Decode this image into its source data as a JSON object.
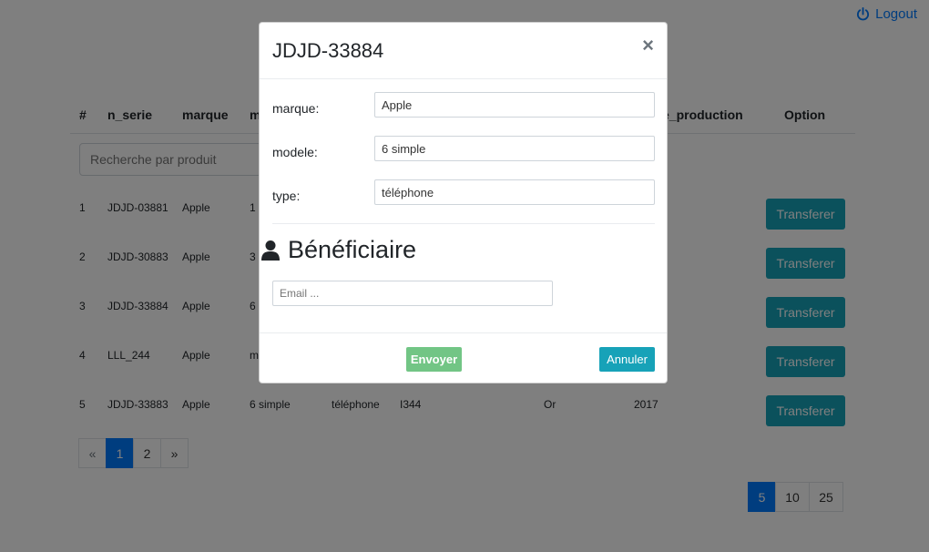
{
  "header": {
    "logout_label": "Logout"
  },
  "table": {
    "columns": [
      "#",
      "n_serie",
      "marque",
      "m",
      "e_production",
      "Option"
    ],
    "search_placeholder": "Recherche par produit",
    "rows": [
      {
        "index": "1",
        "n_serie": "JDJD-03881",
        "marque": "Apple",
        "modele": "1"
      },
      {
        "index": "2",
        "n_serie": "JDJD-30883",
        "marque": "Apple",
        "modele": "3"
      },
      {
        "index": "3",
        "n_serie": "JDJD-33884",
        "marque": "Apple",
        "modele": "6"
      },
      {
        "index": "4",
        "n_serie": "LLL_244",
        "marque": "Apple",
        "modele": "m"
      },
      {
        "index": "5",
        "n_serie": "JDJD-33883",
        "marque": "Apple",
        "modele": "6 simple",
        "type": "téléphone",
        "ref": "I344",
        "couleur": "Or",
        "annee": "2017"
      }
    ],
    "action_label": "Transferer"
  },
  "pagination": {
    "prev": "«",
    "pages": [
      "1",
      "2"
    ],
    "next": "»",
    "page_sizes": [
      "5",
      "10",
      "25"
    ]
  },
  "modal": {
    "title": "JDJD-33884",
    "close": "×",
    "fields": [
      {
        "label": "marque:",
        "value": "Apple"
      },
      {
        "label": "modele:",
        "value": "6 simple"
      },
      {
        "label": "type:",
        "value": "téléphone"
      }
    ],
    "beneficiary_heading": "Bénéficiaire",
    "email_placeholder": "Email ...",
    "send_label": "Envoyer",
    "cancel_label": "Annuler"
  },
  "colors": {
    "primary": "#007bff",
    "info": "#17a2b8",
    "success": "#28a745"
  }
}
